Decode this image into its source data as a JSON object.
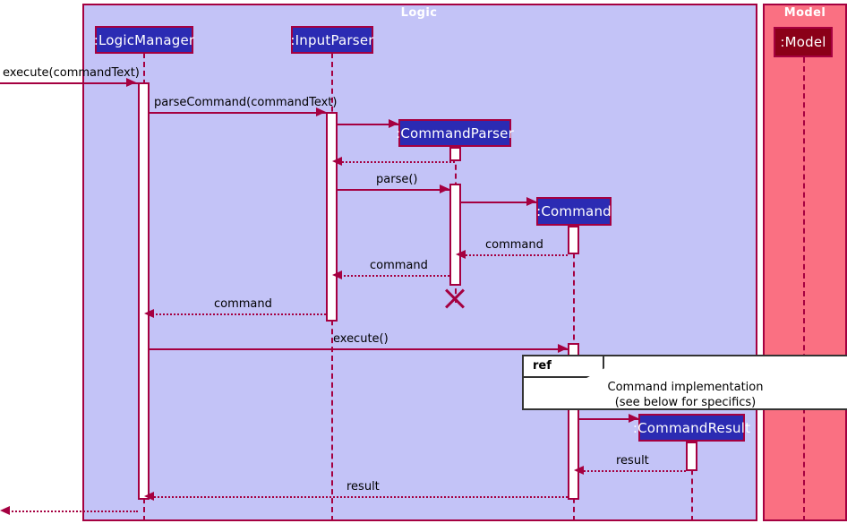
{
  "diagram": {
    "type": "uml-sequence-diagram",
    "title": "Logic command execution sequence"
  },
  "groups": [
    {
      "key": "logic",
      "label": "Logic",
      "color": "#c3c3f7",
      "border": "#a50040"
    },
    {
      "key": "model",
      "label": "Model",
      "color": "#fa7082",
      "border": "#a50040"
    }
  ],
  "participants": [
    {
      "key": "logic_manager",
      "label": ":LogicManager",
      "fill": "#2b2bb3",
      "group": "Logic"
    },
    {
      "key": "input_parser",
      "label": ":InputParser",
      "fill": "#2b2bb3",
      "group": "Logic"
    },
    {
      "key": "command_parser",
      "label": ":CommandParser",
      "fill": "#2b2bb3",
      "group": "Logic"
    },
    {
      "key": "command",
      "label": ":Command",
      "fill": "#2b2bb3",
      "group": "Logic"
    },
    {
      "key": "command_result",
      "label": ":CommandResult",
      "fill": "#2b2bb3",
      "group": "Logic"
    },
    {
      "key": "model",
      "label": ":Model",
      "fill": "#8b0018",
      "group": "Model"
    }
  ],
  "messages": [
    {
      "key": "m1",
      "label": "execute(commandText)",
      "kind": "call",
      "from": "external",
      "to": "logic_manager"
    },
    {
      "key": "m2",
      "label": "parseCommand(commandText)",
      "kind": "call",
      "from": "logic_manager",
      "to": "input_parser"
    },
    {
      "key": "m3",
      "label": "",
      "kind": "create",
      "from": "input_parser",
      "to": "command_parser"
    },
    {
      "key": "m4",
      "label": "",
      "kind": "return",
      "from": "command_parser",
      "to": "input_parser"
    },
    {
      "key": "m5",
      "label": "parse()",
      "kind": "call",
      "from": "input_parser",
      "to": "command_parser"
    },
    {
      "key": "m6",
      "label": "",
      "kind": "create",
      "from": "command_parser",
      "to": "command"
    },
    {
      "key": "m7",
      "label": "command",
      "kind": "return",
      "from": "command",
      "to": "command_parser"
    },
    {
      "key": "m8",
      "label": "command",
      "kind": "return",
      "from": "command_parser",
      "to": "input_parser"
    },
    {
      "key": "m9",
      "label": "command",
      "kind": "return",
      "from": "input_parser",
      "to": "logic_manager"
    },
    {
      "key": "m10",
      "label": "execute()",
      "kind": "call",
      "from": "logic_manager",
      "to": "command"
    },
    {
      "key": "m11",
      "label": "",
      "kind": "create",
      "from": "command",
      "to": "command_result"
    },
    {
      "key": "m12",
      "label": "result",
      "kind": "return",
      "from": "command_result",
      "to": "command"
    },
    {
      "key": "m13",
      "label": "result",
      "kind": "return",
      "from": "command",
      "to": "logic_manager"
    },
    {
      "key": "m14",
      "label": "",
      "kind": "return",
      "from": "logic_manager",
      "to": "external"
    }
  ],
  "fragments": [
    {
      "key": "ref1",
      "operator": "ref",
      "line1": "Command implementation",
      "line2": "(see below for specifics)"
    }
  ],
  "destructions": [
    {
      "key": "d1",
      "participant": "command_parser"
    }
  ]
}
